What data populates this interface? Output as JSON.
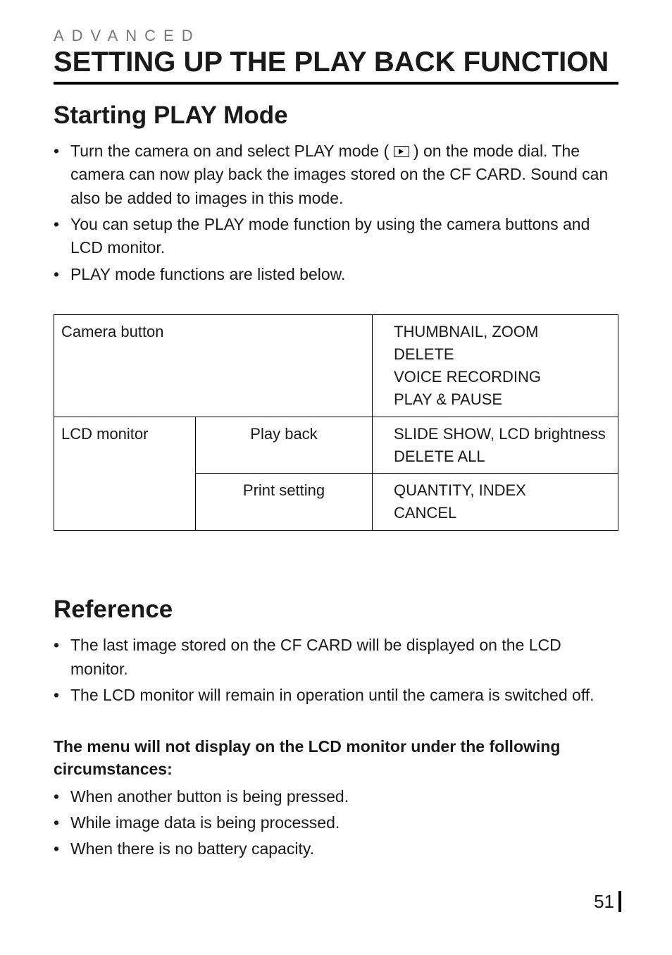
{
  "header": {
    "kicker": "ADVANCED",
    "title": "SETTING UP THE PLAY BACK FUNCTION"
  },
  "section1": {
    "heading": "Starting PLAY Mode",
    "bullets": {
      "b1_before": "Turn the camera on and select PLAY mode ( ",
      "b1_after": " ) on the mode dial. The camera can now play back the images stored on the CF CARD. Sound can also be added to images in this mode.",
      "b2": "You can setup the PLAY mode function by using the camera buttons and LCD monitor.",
      "b3": "PLAY mode functions are listed below."
    }
  },
  "table": {
    "rows": [
      {
        "col_a": "Camera button",
        "col_b": "",
        "col_c": "THUMBNAIL, ZOOM\nDELETE\nVOICE RECORDING\nPLAY & PAUSE"
      },
      {
        "col_a": "LCD monitor",
        "col_b": "Play back",
        "col_c": "SLIDE SHOW, LCD brightness\nDELETE ALL"
      },
      {
        "col_a": "",
        "col_b": "Print setting",
        "col_c": "QUANTITY, INDEX\nCANCEL"
      }
    ]
  },
  "section2": {
    "heading": "Reference",
    "bullets": {
      "r1": "The last image stored on the CF CARD will be displayed on the LCD monitor.",
      "r2": "The LCD monitor will remain in operation until the camera is switched off."
    },
    "warn_heading": "The menu will not display on the LCD monitor under the following circumstances:",
    "warn_bullets": {
      "w1": "When another button is being pressed.",
      "w2": "While image data is being processed.",
      "w3": "When there is no battery capacity."
    }
  },
  "page_number": "51"
}
